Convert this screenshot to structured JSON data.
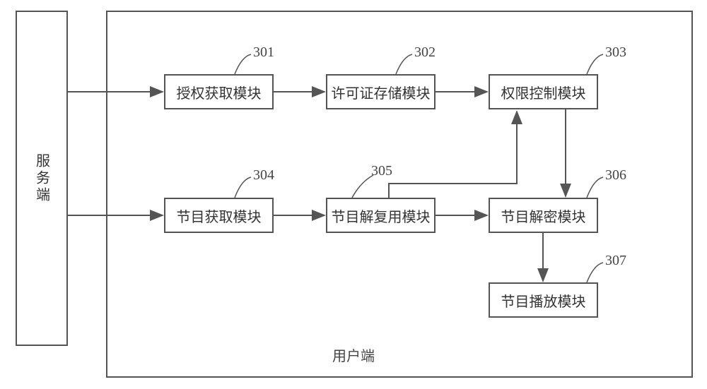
{
  "server_label": "服务端",
  "client_label": "用户端",
  "boxes": {
    "b301": {
      "label": "授权获取模块",
      "num": "301"
    },
    "b302": {
      "label": "许可证存储模块",
      "num": "302"
    },
    "b303": {
      "label": "权限控制模块",
      "num": "303"
    },
    "b304": {
      "label": "节目获取模块",
      "num": "304"
    },
    "b305": {
      "label": "节目解复用模块",
      "num": "305"
    },
    "b306": {
      "label": "节目解密模块",
      "num": "306"
    },
    "b307": {
      "label": "节目播放模块",
      "num": "307"
    }
  }
}
